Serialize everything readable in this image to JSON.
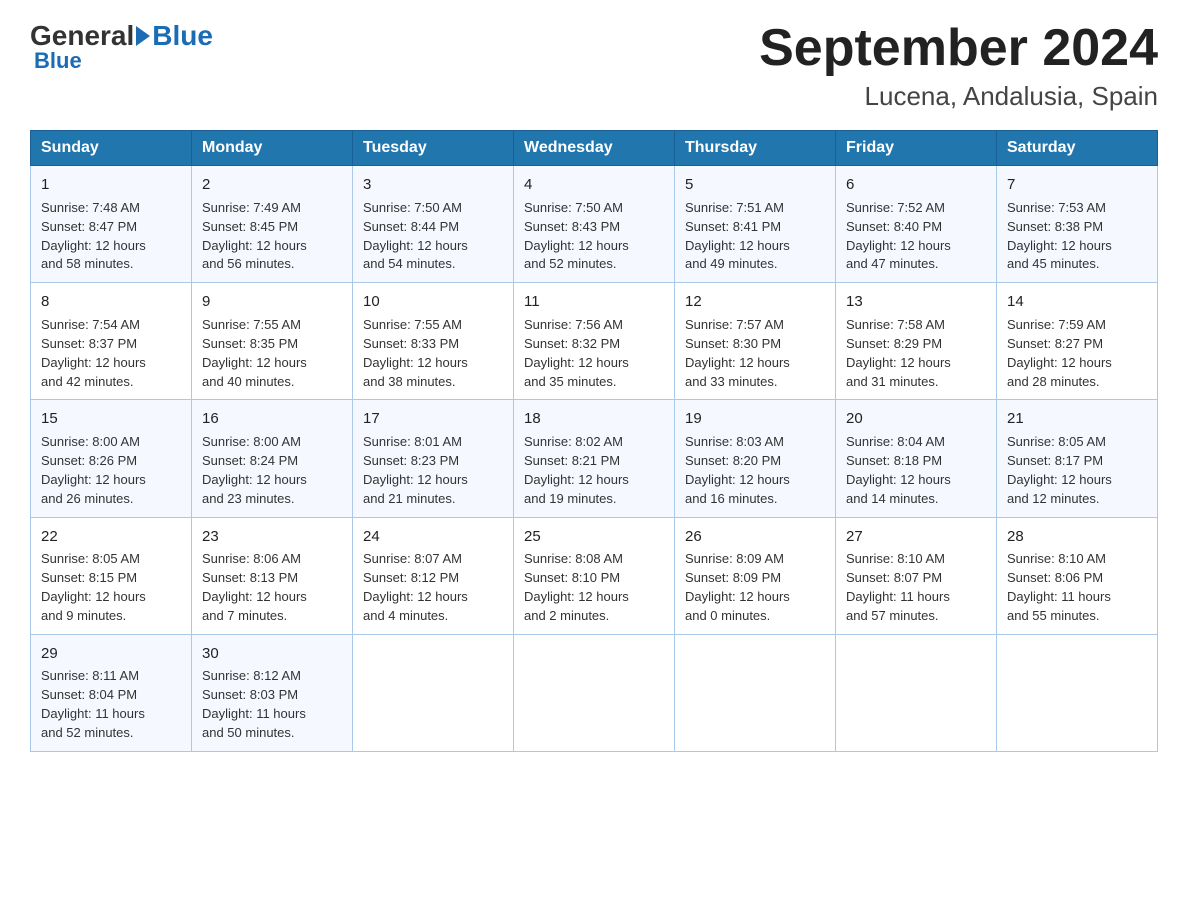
{
  "header": {
    "logo_general": "General",
    "logo_blue": "Blue",
    "title": "September 2024",
    "subtitle": "Lucena, Andalusia, Spain"
  },
  "weekdays": [
    "Sunday",
    "Monday",
    "Tuesday",
    "Wednesday",
    "Thursday",
    "Friday",
    "Saturday"
  ],
  "weeks": [
    [
      {
        "day": "1",
        "sunrise": "7:48 AM",
        "sunset": "8:47 PM",
        "daylight": "12 hours and 58 minutes."
      },
      {
        "day": "2",
        "sunrise": "7:49 AM",
        "sunset": "8:45 PM",
        "daylight": "12 hours and 56 minutes."
      },
      {
        "day": "3",
        "sunrise": "7:50 AM",
        "sunset": "8:44 PM",
        "daylight": "12 hours and 54 minutes."
      },
      {
        "day": "4",
        "sunrise": "7:50 AM",
        "sunset": "8:43 PM",
        "daylight": "12 hours and 52 minutes."
      },
      {
        "day": "5",
        "sunrise": "7:51 AM",
        "sunset": "8:41 PM",
        "daylight": "12 hours and 49 minutes."
      },
      {
        "day": "6",
        "sunrise": "7:52 AM",
        "sunset": "8:40 PM",
        "daylight": "12 hours and 47 minutes."
      },
      {
        "day": "7",
        "sunrise": "7:53 AM",
        "sunset": "8:38 PM",
        "daylight": "12 hours and 45 minutes."
      }
    ],
    [
      {
        "day": "8",
        "sunrise": "7:54 AM",
        "sunset": "8:37 PM",
        "daylight": "12 hours and 42 minutes."
      },
      {
        "day": "9",
        "sunrise": "7:55 AM",
        "sunset": "8:35 PM",
        "daylight": "12 hours and 40 minutes."
      },
      {
        "day": "10",
        "sunrise": "7:55 AM",
        "sunset": "8:33 PM",
        "daylight": "12 hours and 38 minutes."
      },
      {
        "day": "11",
        "sunrise": "7:56 AM",
        "sunset": "8:32 PM",
        "daylight": "12 hours and 35 minutes."
      },
      {
        "day": "12",
        "sunrise": "7:57 AM",
        "sunset": "8:30 PM",
        "daylight": "12 hours and 33 minutes."
      },
      {
        "day": "13",
        "sunrise": "7:58 AM",
        "sunset": "8:29 PM",
        "daylight": "12 hours and 31 minutes."
      },
      {
        "day": "14",
        "sunrise": "7:59 AM",
        "sunset": "8:27 PM",
        "daylight": "12 hours and 28 minutes."
      }
    ],
    [
      {
        "day": "15",
        "sunrise": "8:00 AM",
        "sunset": "8:26 PM",
        "daylight": "12 hours and 26 minutes."
      },
      {
        "day": "16",
        "sunrise": "8:00 AM",
        "sunset": "8:24 PM",
        "daylight": "12 hours and 23 minutes."
      },
      {
        "day": "17",
        "sunrise": "8:01 AM",
        "sunset": "8:23 PM",
        "daylight": "12 hours and 21 minutes."
      },
      {
        "day": "18",
        "sunrise": "8:02 AM",
        "sunset": "8:21 PM",
        "daylight": "12 hours and 19 minutes."
      },
      {
        "day": "19",
        "sunrise": "8:03 AM",
        "sunset": "8:20 PM",
        "daylight": "12 hours and 16 minutes."
      },
      {
        "day": "20",
        "sunrise": "8:04 AM",
        "sunset": "8:18 PM",
        "daylight": "12 hours and 14 minutes."
      },
      {
        "day": "21",
        "sunrise": "8:05 AM",
        "sunset": "8:17 PM",
        "daylight": "12 hours and 12 minutes."
      }
    ],
    [
      {
        "day": "22",
        "sunrise": "8:05 AM",
        "sunset": "8:15 PM",
        "daylight": "12 hours and 9 minutes."
      },
      {
        "day": "23",
        "sunrise": "8:06 AM",
        "sunset": "8:13 PM",
        "daylight": "12 hours and 7 minutes."
      },
      {
        "day": "24",
        "sunrise": "8:07 AM",
        "sunset": "8:12 PM",
        "daylight": "12 hours and 4 minutes."
      },
      {
        "day": "25",
        "sunrise": "8:08 AM",
        "sunset": "8:10 PM",
        "daylight": "12 hours and 2 minutes."
      },
      {
        "day": "26",
        "sunrise": "8:09 AM",
        "sunset": "8:09 PM",
        "daylight": "12 hours and 0 minutes."
      },
      {
        "day": "27",
        "sunrise": "8:10 AM",
        "sunset": "8:07 PM",
        "daylight": "11 hours and 57 minutes."
      },
      {
        "day": "28",
        "sunrise": "8:10 AM",
        "sunset": "8:06 PM",
        "daylight": "11 hours and 55 minutes."
      }
    ],
    [
      {
        "day": "29",
        "sunrise": "8:11 AM",
        "sunset": "8:04 PM",
        "daylight": "11 hours and 52 minutes."
      },
      {
        "day": "30",
        "sunrise": "8:12 AM",
        "sunset": "8:03 PM",
        "daylight": "11 hours and 50 minutes."
      },
      null,
      null,
      null,
      null,
      null
    ]
  ],
  "labels": {
    "sunrise": "Sunrise:",
    "sunset": "Sunset:",
    "daylight": "Daylight:"
  }
}
